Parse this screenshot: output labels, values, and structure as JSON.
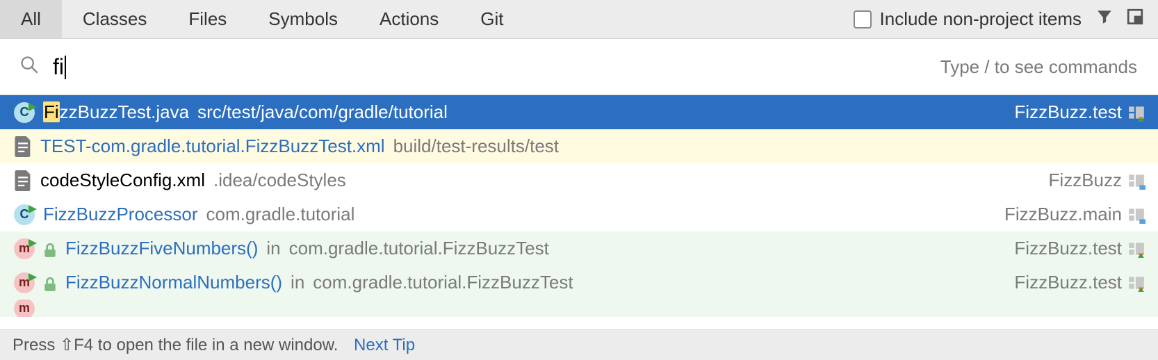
{
  "tabs": [
    "All",
    "Classes",
    "Files",
    "Symbols",
    "Actions",
    "Git"
  ],
  "active_tab_index": 0,
  "include_label": "Include non-project items",
  "include_checked": false,
  "search": {
    "value": "fi",
    "hint": "Type / to see commands"
  },
  "results": [
    {
      "icon": "c-class",
      "highlight_prefix": "Fi",
      "name_rest": "zzBuzzTest.java",
      "location": "src/test/java/com/gradle/tutorial",
      "module": "FizzBuzz.test",
      "mod_icon": "test",
      "style": "selected"
    },
    {
      "icon": "xml-file",
      "name": "TEST-com.gradle.tutorial.FizzBuzzTest.xml",
      "location": "build/test-results/test",
      "module": "",
      "mod_icon": "",
      "style": "yellow"
    },
    {
      "icon": "xml-file",
      "name": "codeStyleConfig.xml",
      "location": ".idea/codeStyles",
      "module": "FizzBuzz",
      "mod_icon": "src",
      "style": "plain"
    },
    {
      "icon": "c-class",
      "name": "FizzBuzzProcessor",
      "location": "com.gradle.tutorial",
      "module": "FizzBuzz.main",
      "mod_icon": "src",
      "style": "plain-link"
    },
    {
      "icon": "m-method",
      "lock": true,
      "name": "FizzBuzzFiveNumbers()",
      "in_word": "in",
      "location": "com.gradle.tutorial.FizzBuzzTest",
      "module": "FizzBuzz.test",
      "mod_icon": "test",
      "style": "green"
    },
    {
      "icon": "m-method",
      "lock": true,
      "name": "FizzBuzzNormalNumbers()",
      "in_word": "in",
      "location": "com.gradle.tutorial.FizzBuzzTest",
      "module": "FizzBuzz.test",
      "mod_icon": "test",
      "style": "green"
    }
  ],
  "footer": {
    "text_before": "Press ",
    "shortcut": "⇧F4",
    "text_after": " to open the file in a new window.",
    "tip_label": "Next Tip"
  }
}
